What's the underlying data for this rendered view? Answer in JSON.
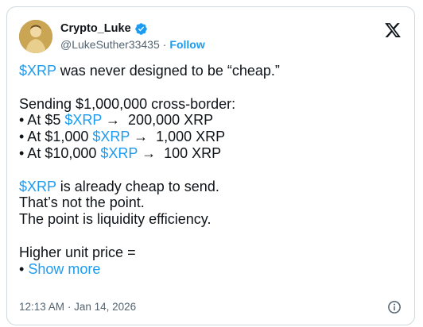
{
  "author": {
    "display_name": "Crypto_Luke",
    "handle": "@LukeSuther33435",
    "separator": "·",
    "follow_label": "Follow"
  },
  "icons": {
    "verified": "verified-badge-icon",
    "platform": "x-logo-icon",
    "info": "info-icon"
  },
  "colors": {
    "accent": "#1d9bf0",
    "text": "#0f1419",
    "muted": "#536471",
    "border": "#cfd9de"
  },
  "tweet": {
    "line1": {
      "cashtag": "$XRP",
      "rest": " was never designed to be “cheap.”"
    },
    "line2": "Sending $1,000,000 cross-border:",
    "bullets": [
      {
        "prefix": "• At $5 ",
        "cashtag": "$XRP",
        "suffix": " →  200,000 XRP"
      },
      {
        "prefix": "• At $1,000 ",
        "cashtag": "$XRP",
        "suffix": " →  1,000 XRP"
      },
      {
        "prefix": "• At $10,000 ",
        "cashtag": "$XRP",
        "suffix": " →  100 XRP"
      }
    ],
    "line6": {
      "cashtag": "$XRP",
      "rest": " is already cheap to send."
    },
    "line7": "That’s not the point.",
    "line8": "The point is liquidity efficiency.",
    "line9": "Higher unit price =",
    "show_more": {
      "prefix": "• ",
      "label": "Show more"
    }
  },
  "timestamp": {
    "time": "12:13 AM",
    "separator": "·",
    "date": "Jan 14, 2026"
  }
}
